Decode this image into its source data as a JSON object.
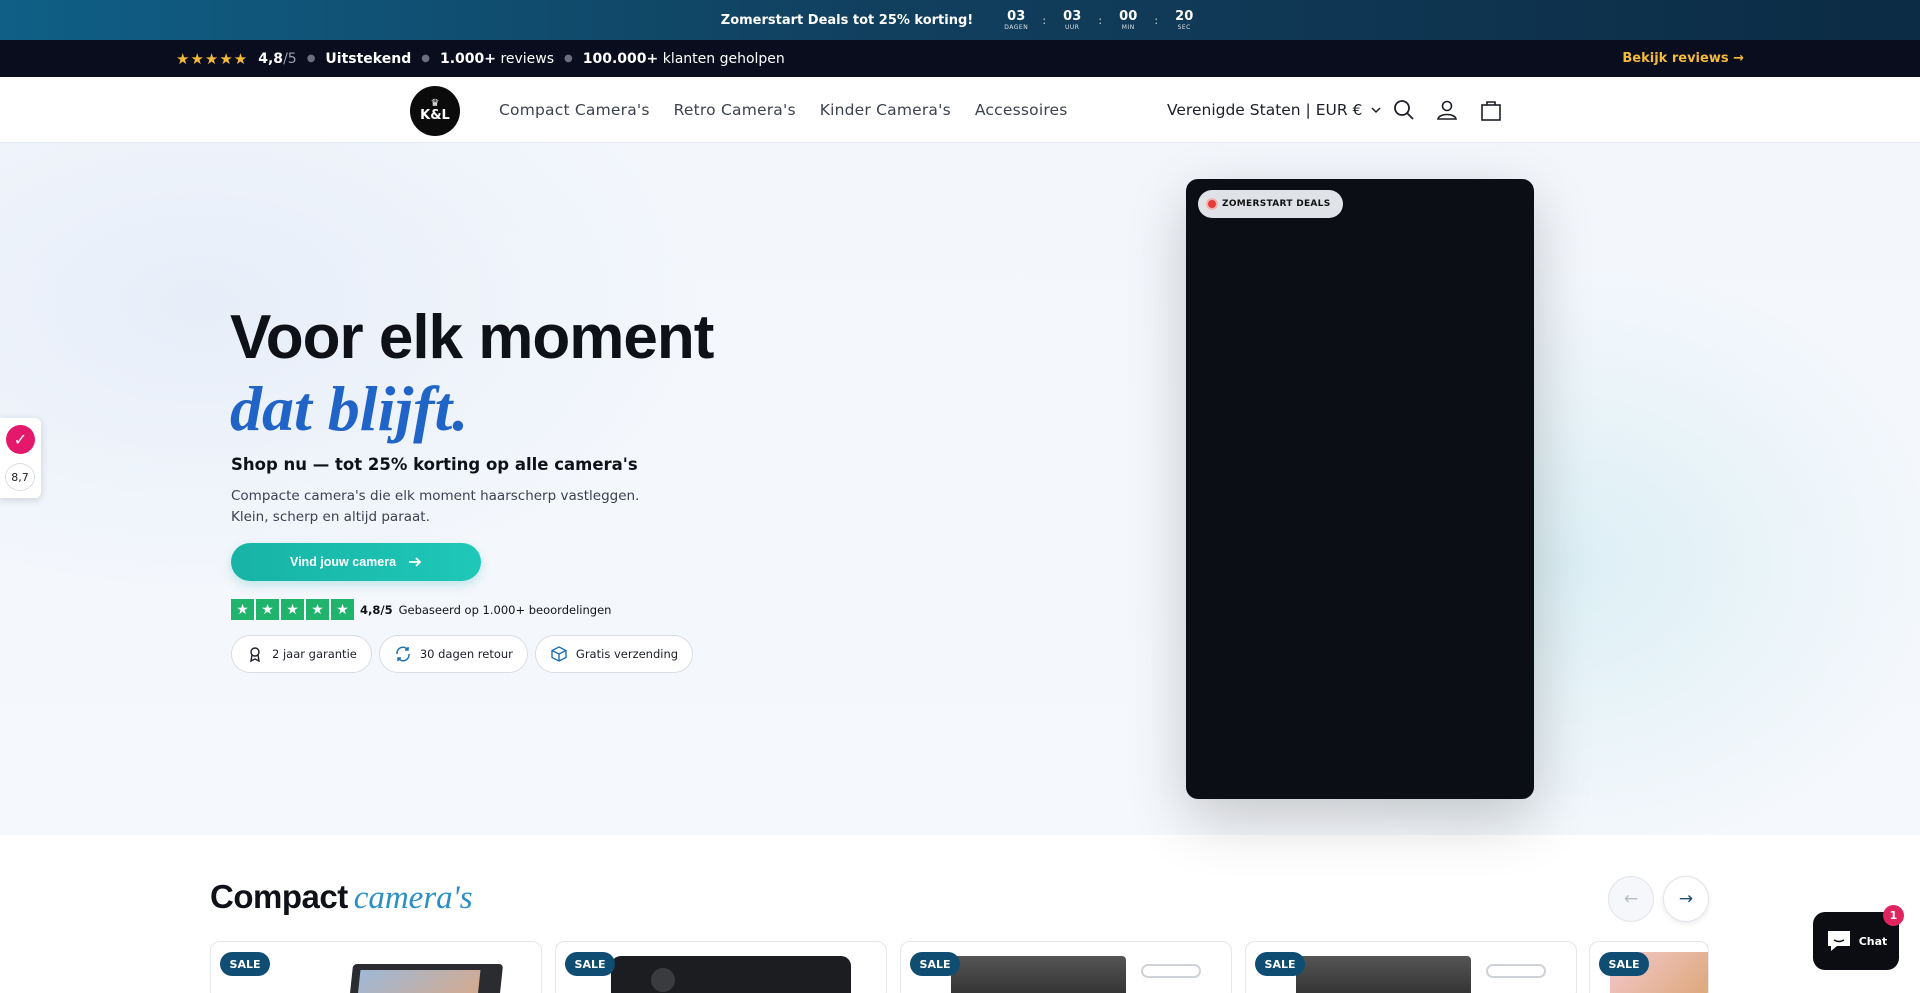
{
  "countdown": {
    "promo": "Zomerstart Deals tot 25% korting!",
    "units": [
      {
        "value": "03",
        "label": "DAGEN"
      },
      {
        "value": "03",
        "label": "UUR"
      },
      {
        "value": "00",
        "label": "MIN"
      },
      {
        "value": "20",
        "label": "SEC"
      }
    ],
    "separator": ":"
  },
  "reviews_bar": {
    "stars": "★★★★★",
    "rating": "4,8",
    "rating_suffix": "/5",
    "verdict": "Uitstekend",
    "reviews_count": "1.000+",
    "reviews_label": "reviews",
    "customers_count": "100.000+",
    "customers_label": "klanten geholpen",
    "link": "Bekijk reviews →"
  },
  "header": {
    "logo_crown": "♛",
    "logo_text": "K&L",
    "nav": [
      "Compact Camera's",
      "Retro Camera's",
      "Kinder Camera's",
      "Accessoires"
    ],
    "region": "Verenigde Staten | EUR €"
  },
  "hero": {
    "title": "Voor elk moment",
    "title_script": "dat blijft.",
    "subhead": "Shop nu — tot 25% korting op alle camera's",
    "desc_line1": "Compacte camera's die elk moment haarscherp vastleggen.",
    "desc_line2": "Klein, scherp en altijd paraat.",
    "cta": "Vind jouw camera",
    "rating_value": "4,8/5",
    "rating_text": "Gebaseerd op 1.000+ beoordelingen",
    "badges": [
      "2 jaar garantie",
      "30 dagen retour",
      "Gratis verzending"
    ],
    "video_badge": "ZOMERSTART DEALS"
  },
  "side_widget": {
    "score": "8,7"
  },
  "section": {
    "title_bold": "Compact",
    "title_italic": "camera's",
    "sale_label": "SALE"
  },
  "chat": {
    "label": "Chat",
    "count": "1"
  },
  "colors": {
    "accent_teal": "#17b3a6",
    "brand_blue": "#2164c7",
    "gold": "#f5b93b",
    "trustpilot_green": "#1fb36b"
  }
}
